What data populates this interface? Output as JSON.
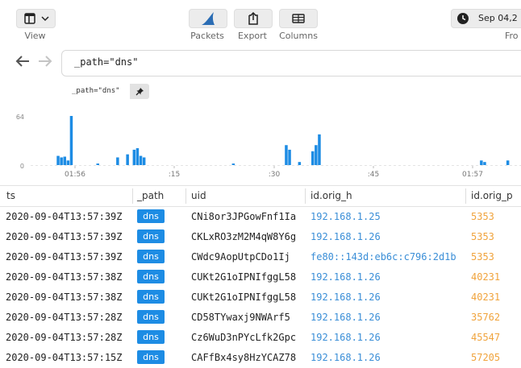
{
  "toolbar": {
    "view_label": "View",
    "packets_label": "Packets",
    "export_label": "Export",
    "columns_label": "Columns",
    "date_text": "Sep 04,2",
    "from_label": "Fro"
  },
  "search": {
    "query": "_path=\"dns\""
  },
  "filter_pill": {
    "label": "_path=\"dns\"",
    "pin_icon": "pin-icon"
  },
  "histogram": {
    "y_ticks": [
      "64",
      "0"
    ],
    "x_ticks": [
      "01:56",
      ":15",
      ":30",
      ":45",
      "01:57"
    ],
    "bar_color": "#1d8ce4",
    "counts": [
      0,
      0,
      0,
      12,
      10,
      11,
      6,
      64,
      0,
      0,
      0,
      0,
      0,
      0,
      0,
      2,
      0,
      0,
      0,
      0,
      0,
      10,
      0,
      0,
      14,
      0,
      20,
      22,
      12,
      10,
      0,
      0,
      0,
      0,
      0,
      0,
      0,
      0,
      0,
      0,
      0,
      0,
      0,
      0,
      0,
      0,
      0,
      0,
      0,
      0,
      0,
      0,
      0,
      0,
      0,
      0,
      2,
      0,
      0,
      0,
      0,
      0,
      0,
      0,
      0,
      0,
      0,
      0,
      0,
      0,
      0,
      0,
      26,
      20,
      0,
      0,
      4,
      0,
      0,
      0,
      18,
      26,
      40,
      0,
      0,
      0,
      0,
      0,
      0,
      0,
      0,
      0,
      0,
      0,
      0,
      0,
      0,
      0,
      0,
      0,
      0,
      0,
      0,
      0,
      0,
      0,
      0,
      0,
      0,
      0,
      0,
      0,
      0,
      0,
      0,
      0,
      0,
      0,
      0,
      0,
      0,
      0,
      0,
      0,
      0,
      0,
      0,
      0,
      0,
      0,
      0,
      6,
      4,
      0,
      0,
      0,
      0,
      0,
      0,
      6,
      0,
      0,
      0,
      0,
      0,
      0,
      0,
      0,
      0,
      0,
      0,
      0,
      0,
      0,
      0,
      0,
      0,
      6,
      0,
      2
    ]
  },
  "table": {
    "headers": [
      "ts",
      "_path",
      "uid",
      "id.orig_h",
      "id.orig_p"
    ],
    "rows": [
      {
        "ts": "2020-09-04T13:57:39Z",
        "path": "dns",
        "uid": "CNi8or3JPGowFnf1Ia",
        "orig_h": "192.168.1.25",
        "orig_p": "5353"
      },
      {
        "ts": "2020-09-04T13:57:39Z",
        "path": "dns",
        "uid": "CKLxRO3zM2M4qW8Y6g",
        "orig_h": "192.168.1.26",
        "orig_p": "5353"
      },
      {
        "ts": "2020-09-04T13:57:39Z",
        "path": "dns",
        "uid": "CWdc9AopUtpCDo1Ij",
        "orig_h": "fe80::143d:eb6c:c796:2d1b",
        "orig_p": "5353"
      },
      {
        "ts": "2020-09-04T13:57:38Z",
        "path": "dns",
        "uid": "CUKt2G1oIPNIfggL58",
        "orig_h": "192.168.1.26",
        "orig_p": "40231"
      },
      {
        "ts": "2020-09-04T13:57:38Z",
        "path": "dns",
        "uid": "CUKt2G1oIPNIfggL58",
        "orig_h": "192.168.1.26",
        "orig_p": "40231"
      },
      {
        "ts": "2020-09-04T13:57:28Z",
        "path": "dns",
        "uid": "CD58TYwaxj9NWArf5",
        "orig_h": "192.168.1.26",
        "orig_p": "35762"
      },
      {
        "ts": "2020-09-04T13:57:28Z",
        "path": "dns",
        "uid": "Cz6WuD3nPYcLfk2Gpc",
        "orig_h": "192.168.1.26",
        "orig_p": "45547"
      },
      {
        "ts": "2020-09-04T13:57:15Z",
        "path": "dns",
        "uid": "CAFfBx4sy8HzYCAZ78",
        "orig_h": "192.168.1.26",
        "orig_p": "57205"
      }
    ]
  }
}
